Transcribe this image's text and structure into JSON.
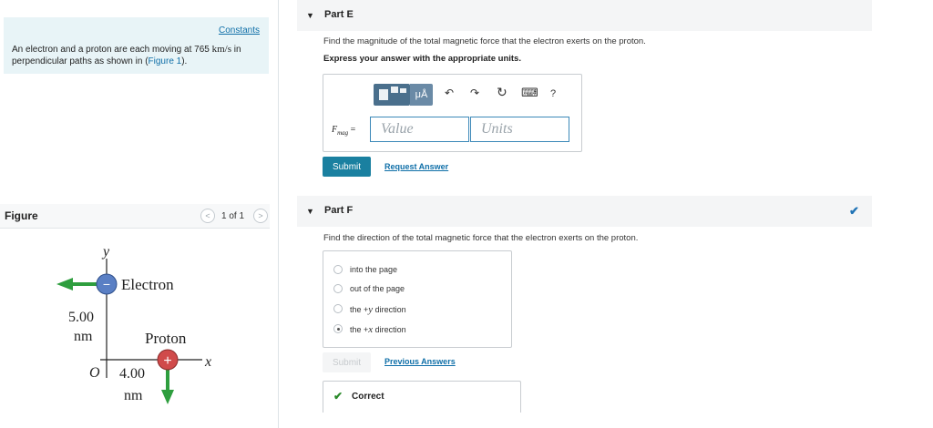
{
  "problem": {
    "constants_label": "Constants",
    "text_before": "An electron and a proton are each moving at 765 ",
    "speed_unit": "km/s",
    "text_middle": " in perpendicular paths as shown in (",
    "figure_link": "Figure 1",
    "text_after": ")."
  },
  "figure_panel": {
    "label": "Figure",
    "pager_prev": "<",
    "pager_count": "1 of 1",
    "pager_next": ">",
    "diagram": {
      "y_axis": "y",
      "x_axis": "x",
      "origin": "O",
      "electron_label": "Electron",
      "electron_sign": "−",
      "proton_label": "Proton",
      "proton_sign": "+",
      "vertical_distance_value": "5.00",
      "vertical_distance_unit": "nm",
      "horizontal_distance_value": "4.00",
      "horizontal_distance_unit": "nm",
      "colors": {
        "arrow": "#2e9e3e",
        "electron": "#5a7fc4",
        "proton": "#d04a4a"
      }
    }
  },
  "part_e": {
    "collapse_icon": "▼",
    "title": "Part E",
    "question": "Find the magnitude of the total magnetic force that the electron exerts on the proton.",
    "instruction": "Express your answer with the appropriate units.",
    "toolbar": {
      "template_icon": "template-icon",
      "units_label": "μÅ",
      "undo": "↶",
      "redo": "↷",
      "reset": "↻",
      "keyboard": "⌨",
      "help": "?"
    },
    "variable": "F",
    "variable_sub": "mag",
    "equals": "=",
    "value_placeholder": "Value",
    "units_placeholder": "Units",
    "submit_label": "Submit",
    "request_answer_label": "Request Answer"
  },
  "part_f": {
    "collapse_icon": "▼",
    "title": "Part F",
    "status_icon": "✔",
    "question": "Find the direction of the total magnetic force that the electron exerts on the proton.",
    "options": [
      {
        "label": "into the page",
        "selected": false
      },
      {
        "label": "out of the page",
        "selected": false
      },
      {
        "label_prefix": "the +",
        "label_var": "y",
        "label_suffix": " direction",
        "selected": false
      },
      {
        "label_prefix": "the +",
        "label_var": "x",
        "label_suffix": " direction",
        "selected": true
      }
    ],
    "submit_label": "Submit",
    "previous_answers_label": "Previous Answers",
    "feedback_icon": "✔",
    "feedback_label": "Correct"
  }
}
